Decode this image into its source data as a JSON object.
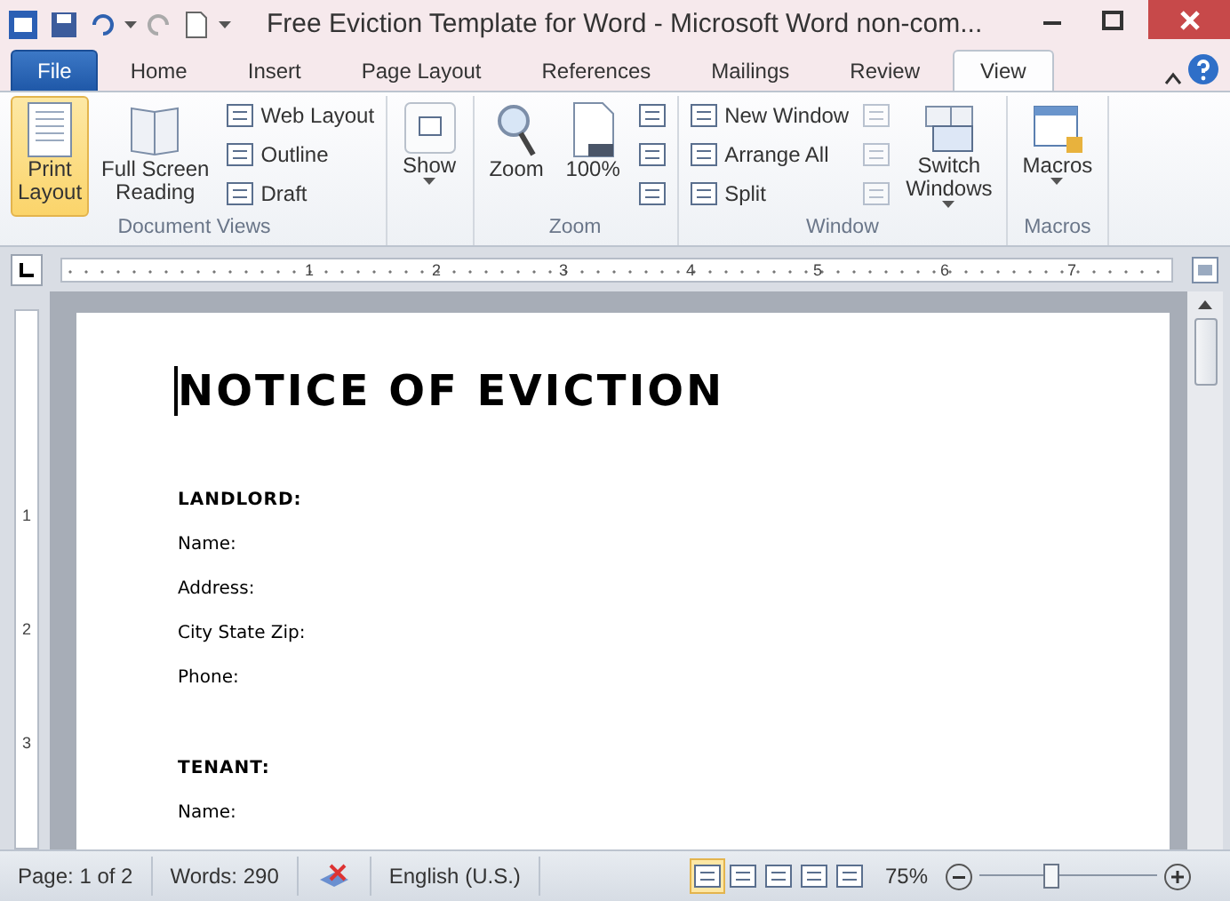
{
  "window": {
    "title": "Free Eviction Template for Word  -  Microsoft Word non-com..."
  },
  "tabs": [
    {
      "label": "File",
      "kind": "file",
      "selected": false
    },
    {
      "label": "Home",
      "kind": "tab",
      "selected": false
    },
    {
      "label": "Insert",
      "kind": "tab",
      "selected": false
    },
    {
      "label": "Page Layout",
      "kind": "tab",
      "selected": false
    },
    {
      "label": "References",
      "kind": "tab",
      "selected": false
    },
    {
      "label": "Mailings",
      "kind": "tab",
      "selected": false
    },
    {
      "label": "Review",
      "kind": "tab",
      "selected": false
    },
    {
      "label": "View",
      "kind": "tab",
      "selected": true
    }
  ],
  "ribbon": {
    "groups": [
      {
        "label": "Document Views",
        "items": [
          {
            "kind": "large",
            "label": "Print\nLayout",
            "selected": true
          },
          {
            "kind": "large",
            "label": "Full Screen\nReading",
            "selected": false
          },
          {
            "kind": "small",
            "label": "Web Layout"
          },
          {
            "kind": "small",
            "label": "Outline"
          },
          {
            "kind": "small",
            "label": "Draft"
          }
        ]
      },
      {
        "items": [
          {
            "kind": "large",
            "label": "Show",
            "dropdown": true,
            "selected": false
          }
        ]
      },
      {
        "label": "Zoom",
        "items": [
          {
            "kind": "large",
            "label": "Zoom",
            "selected": false
          },
          {
            "kind": "large",
            "label": "100%",
            "selected": false
          },
          {
            "kind": "icon",
            "disabled": false
          },
          {
            "kind": "icon",
            "disabled": false
          },
          {
            "kind": "icon",
            "disabled": false
          }
        ]
      },
      {
        "label": "Window",
        "items": [
          {
            "kind": "small",
            "label": "New Window"
          },
          {
            "kind": "small",
            "label": "Arrange All"
          },
          {
            "kind": "small",
            "label": "Split"
          },
          {
            "kind": "icon",
            "disabled": true
          },
          {
            "kind": "icon",
            "disabled": true
          },
          {
            "kind": "icon",
            "disabled": true
          },
          {
            "kind": "large",
            "label": "Switch\nWindows",
            "dropdown": true,
            "selected": false
          }
        ]
      },
      {
        "label": "Macros",
        "items": [
          {
            "kind": "large",
            "label": "Macros",
            "dropdown": true,
            "selected": false
          }
        ]
      }
    ]
  },
  "ruler": {
    "marks": [
      "1",
      "2",
      "3",
      "4",
      "5",
      "6",
      "7"
    ]
  },
  "vertical_ruler": {
    "marks": [
      "1",
      "2",
      "3"
    ]
  },
  "document": {
    "heading": "NOTICE OF EVICTION",
    "sections": [
      {
        "title": "LANDLORD:",
        "fields": [
          "Name:",
          "Address:",
          "City State Zip:",
          "Phone:"
        ]
      },
      {
        "title": "TENANT:",
        "fields": [
          "Name:"
        ]
      }
    ]
  },
  "status_bar": {
    "page": "Page: 1 of 2",
    "words": "Words: 290",
    "language": "English (U.S.)",
    "views": [
      {
        "selected": true
      },
      {
        "selected": false
      },
      {
        "selected": false
      },
      {
        "selected": false
      },
      {
        "selected": false
      }
    ],
    "zoom": "75%",
    "level": 0.4
  }
}
